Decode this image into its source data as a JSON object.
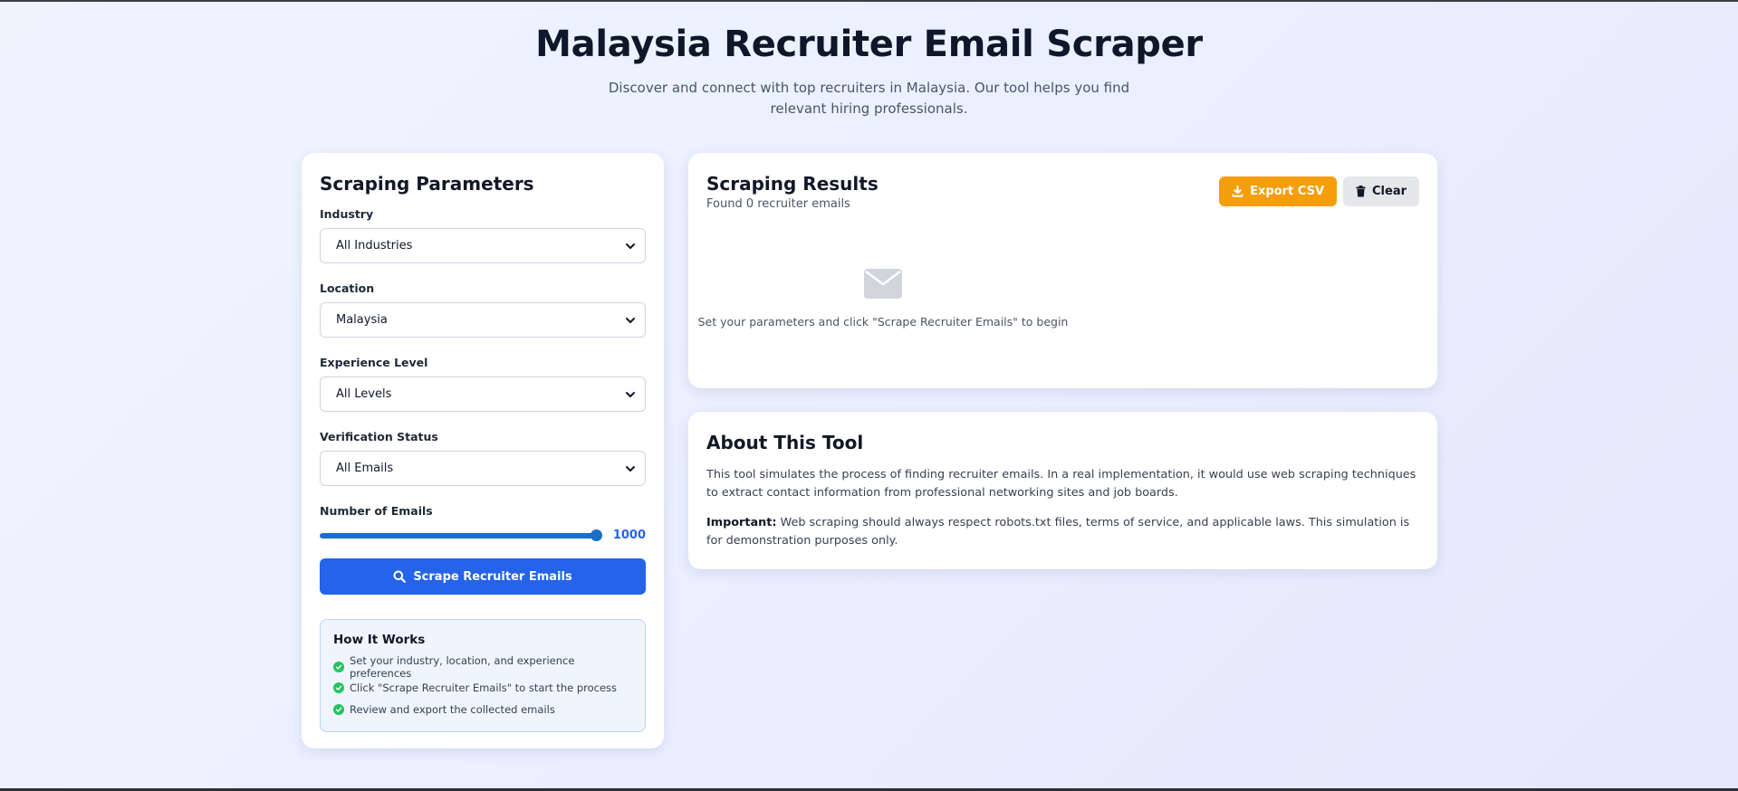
{
  "header": {
    "title": "Malaysia Recruiter Email Scraper",
    "subtitle": "Discover and connect with top recruiters in Malaysia. Our tool helps you find relevant hiring professionals."
  },
  "params": {
    "title": "Scraping Parameters",
    "industry": {
      "label": "Industry",
      "value": "All Industries"
    },
    "location": {
      "label": "Location",
      "value": "Malaysia"
    },
    "experience": {
      "label": "Experience Level",
      "value": "All Levels"
    },
    "verification": {
      "label": "Verification Status",
      "value": "All Emails"
    },
    "emails": {
      "label": "Number of Emails",
      "value": "1000",
      "slider_fraction": 1.0
    },
    "scrape_button": "Scrape Recruiter Emails",
    "how_it_works": {
      "title": "How It Works",
      "steps": [
        "Set your industry, location, and experience preferences",
        "Click \"Scrape Recruiter Emails\" to start the process",
        "Review and export the collected emails"
      ]
    }
  },
  "results": {
    "title": "Scraping Results",
    "count_text": "Found 0 recruiter emails",
    "export_label": "Export CSV",
    "clear_label": "Clear",
    "empty_message": "Set your parameters and click \"Scrape Recruiter Emails\" to begin"
  },
  "about": {
    "title": "About This Tool",
    "paragraph": "This tool simulates the process of finding recruiter emails. In a real implementation, it would use web scraping techniques to extract contact information from professional networking sites and job boards.",
    "important_label": "Important:",
    "important_text": " Web scraping should always respect robots.txt files, terms of service, and applicable laws. This simulation is for demonstration purposes only."
  },
  "colors": {
    "primary": "#2563eb",
    "export": "#f59e0b",
    "check": "#22c55e",
    "slider": "#1b6fc7"
  },
  "icons": [
    "chevron-down-icon",
    "search-icon",
    "download-icon",
    "trash-icon",
    "envelope-icon",
    "check-circle-icon"
  ]
}
